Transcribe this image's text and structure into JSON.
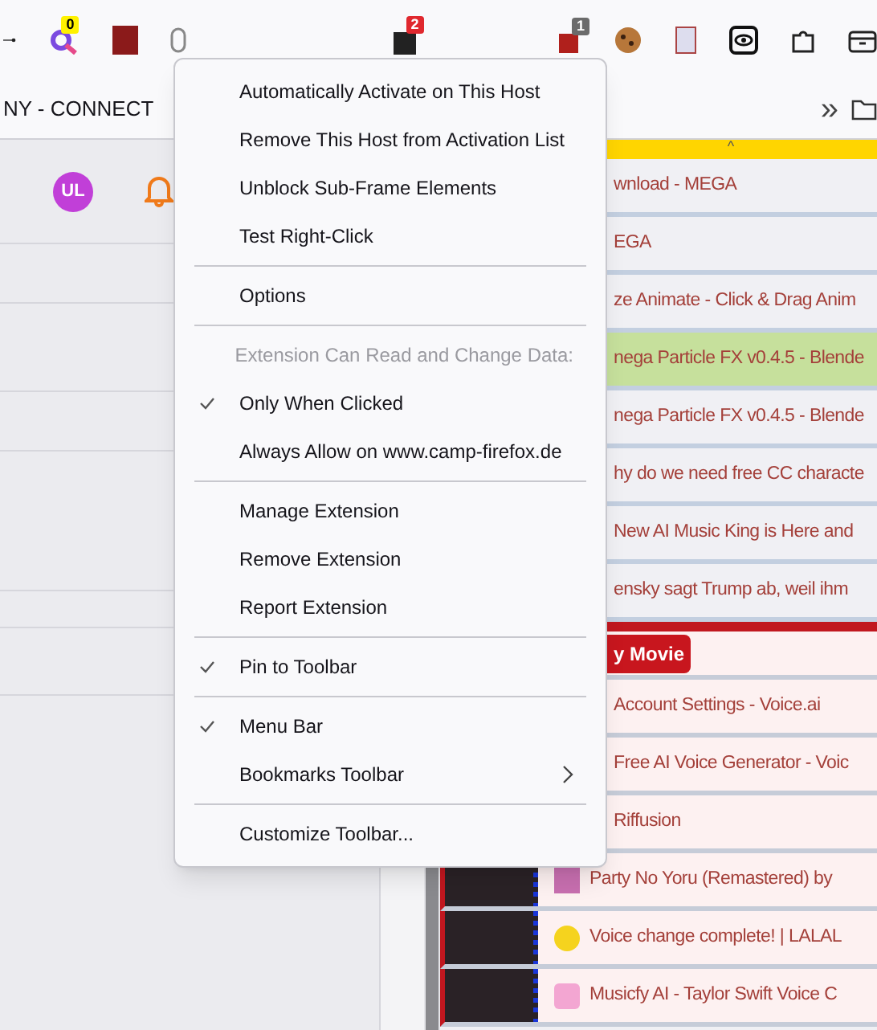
{
  "toolbar": {
    "badges": [
      {
        "kind": "yellow",
        "text": "0"
      },
      {
        "kind": "red",
        "text": "2"
      },
      {
        "kind": "gray",
        "text": "1"
      }
    ]
  },
  "bookmarks_bar": {
    "items": [
      "NY - CONNECT"
    ],
    "overflow": "»"
  },
  "page": {
    "avatar": "UL",
    "banner_caret": "^",
    "rows": [
      {
        "kind": "plain",
        "text": "wnload - MEGA",
        "highlighted": false
      },
      {
        "kind": "plain",
        "text": "EGA",
        "highlighted": false
      },
      {
        "kind": "plain",
        "text": "ze Animate - Click & Drag Anim",
        "highlighted": false
      },
      {
        "kind": "plain",
        "text": "nega Particle FX v0.4.5 - Blende",
        "highlighted": true
      },
      {
        "kind": "plain",
        "text": "nega Particle FX v0.4.5 - Blende",
        "highlighted": false
      },
      {
        "kind": "plain",
        "text": "hy do we need free CC characte",
        "highlighted": false
      },
      {
        "kind": "plain",
        "text": "New AI Music King is Here and",
        "highlighted": false
      },
      {
        "kind": "plain",
        "text": "ensky sagt Trump ab, weil ihm",
        "highlighted": false
      },
      {
        "kind": "button",
        "text": "y Movie",
        "highlighted": false
      },
      {
        "kind": "pink",
        "text": "Account Settings - Voice.ai",
        "highlighted": false
      },
      {
        "kind": "pink",
        "text": "Free AI Voice Generator - Voic",
        "highlighted": false
      },
      {
        "kind": "pink",
        "text": "Riffusion",
        "highlighted": false
      },
      {
        "kind": "pink",
        "text": "Party No Yoru (Remastered) by",
        "highlighted": false
      },
      {
        "kind": "pink",
        "text": "Voice change complete! | LALAL",
        "highlighted": false
      },
      {
        "kind": "pink",
        "text": "Musicfy AI - Taylor Swift Voice C",
        "highlighted": false
      }
    ]
  },
  "context_menu": {
    "items": [
      {
        "kind": "item",
        "label": "Automatically Activate on This Host",
        "checked": false,
        "disabled": false
      },
      {
        "kind": "item",
        "label": "Remove This Host from Activation List",
        "checked": false,
        "disabled": false
      },
      {
        "kind": "item",
        "label": "Unblock Sub-Frame Elements",
        "checked": false,
        "disabled": false
      },
      {
        "kind": "item",
        "label": "Test Right-Click",
        "checked": false,
        "disabled": false
      },
      {
        "kind": "separator"
      },
      {
        "kind": "item",
        "label": "Options",
        "checked": false,
        "disabled": false
      },
      {
        "kind": "separator"
      },
      {
        "kind": "item",
        "label": "Extension Can Read and Change Data:",
        "checked": false,
        "disabled": true
      },
      {
        "kind": "item",
        "label": "Only When Clicked",
        "checked": true,
        "disabled": false
      },
      {
        "kind": "item",
        "label": "Always Allow on www.camp-firefox.de",
        "checked": false,
        "disabled": false
      },
      {
        "kind": "separator"
      },
      {
        "kind": "item",
        "label": "Manage Extension",
        "checked": false,
        "disabled": false
      },
      {
        "kind": "item",
        "label": "Remove Extension",
        "checked": false,
        "disabled": false
      },
      {
        "kind": "item",
        "label": "Report Extension",
        "checked": false,
        "disabled": false
      },
      {
        "kind": "separator"
      },
      {
        "kind": "item",
        "label": "Pin to Toolbar",
        "checked": true,
        "disabled": false
      },
      {
        "kind": "separator"
      },
      {
        "kind": "item",
        "label": "Menu Bar",
        "checked": true,
        "disabled": false
      },
      {
        "kind": "submenu",
        "label": "Bookmarks Toolbar",
        "checked": false,
        "disabled": false
      },
      {
        "kind": "separator"
      },
      {
        "kind": "item",
        "label": "Customize Toolbar...",
        "checked": false,
        "disabled": false
      }
    ]
  }
}
